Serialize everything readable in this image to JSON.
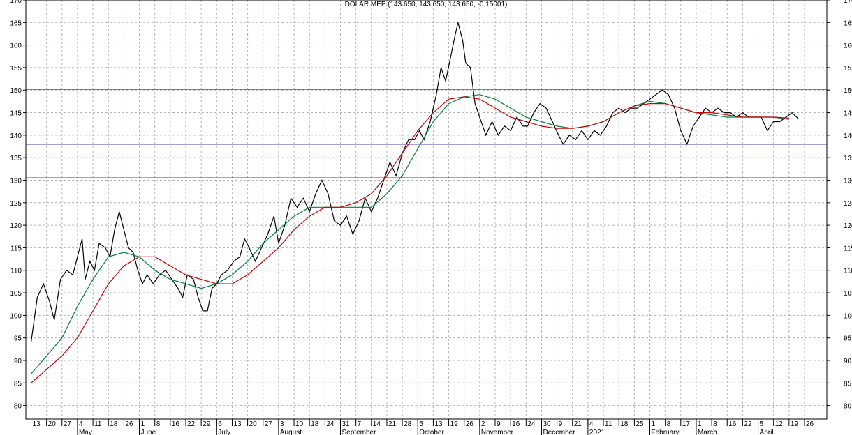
{
  "chart_data": {
    "type": "line",
    "title": "DOLAR MEP (143.650, 143.650, 143.650, -0.15001)",
    "ylim": [
      77,
      170
    ],
    "y_ticks": [
      80,
      85,
      90,
      95,
      100,
      105,
      110,
      115,
      120,
      125,
      130,
      135,
      140,
      145,
      150,
      155,
      160,
      165,
      170
    ],
    "x_day_ticks": [
      "13",
      "20",
      "27",
      "4",
      "11",
      "18",
      "26",
      "1",
      "8",
      "16",
      "22",
      "29",
      "6",
      "13",
      "20",
      "27",
      "3",
      "10",
      "18",
      "24",
      "31",
      "7",
      "14",
      "21",
      "28",
      "5",
      "13",
      "19",
      "26",
      "2",
      "9",
      "16",
      "24",
      "30",
      "9",
      "21",
      "4",
      "11",
      "18",
      "25",
      "1",
      "8",
      "17",
      "1",
      "8",
      "16",
      "22",
      "5",
      "12",
      "19",
      "26"
    ],
    "x_month_labels": [
      {
        "label": "May",
        "index": 3
      },
      {
        "label": "June",
        "index": 7
      },
      {
        "label": "July",
        "index": 12
      },
      {
        "label": "August",
        "index": 16
      },
      {
        "label": "September",
        "index": 20
      },
      {
        "label": "October",
        "index": 25
      },
      {
        "label": "November",
        "index": 29
      },
      {
        "label": "December",
        "index": 33
      },
      {
        "label": "2021",
        "index": 36
      },
      {
        "label": "February",
        "index": 40
      },
      {
        "label": "March",
        "index": 43
      },
      {
        "label": "April",
        "index": 47
      }
    ],
    "h_levels": [
      150.2,
      138,
      130.5
    ],
    "series": [
      {
        "color": "#000000",
        "points": [
          [
            0,
            94
          ],
          [
            0.4,
            104
          ],
          [
            0.8,
            107
          ],
          [
            1.2,
            103
          ],
          [
            1.5,
            99
          ],
          [
            1.9,
            108
          ],
          [
            2.3,
            110
          ],
          [
            2.7,
            109
          ],
          [
            3,
            113
          ],
          [
            3.3,
            117
          ],
          [
            3.5,
            108
          ],
          [
            3.8,
            112
          ],
          [
            4.1,
            110
          ],
          [
            4.4,
            116
          ],
          [
            4.8,
            115
          ],
          [
            5.1,
            113
          ],
          [
            5.4,
            119
          ],
          [
            5.7,
            123
          ],
          [
            6,
            119
          ],
          [
            6.3,
            115
          ],
          [
            6.6,
            114
          ],
          [
            6.9,
            110
          ],
          [
            7.2,
            107
          ],
          [
            7.5,
            109
          ],
          [
            7.9,
            107
          ],
          [
            8.3,
            109
          ],
          [
            8.7,
            110
          ],
          [
            9.1,
            108
          ],
          [
            9.5,
            106
          ],
          [
            9.8,
            104
          ],
          [
            10.1,
            109
          ],
          [
            10.5,
            108
          ],
          [
            10.8,
            104
          ],
          [
            11.1,
            101
          ],
          [
            11.4,
            101
          ],
          [
            11.7,
            106
          ],
          [
            12,
            107
          ],
          [
            12.3,
            109
          ],
          [
            12.7,
            110
          ],
          [
            13.1,
            112
          ],
          [
            13.5,
            113
          ],
          [
            13.8,
            117
          ],
          [
            14.1,
            115
          ],
          [
            14.5,
            112
          ],
          [
            14.9,
            115
          ],
          [
            15.3,
            118
          ],
          [
            15.7,
            122
          ],
          [
            16,
            116
          ],
          [
            16.4,
            120
          ],
          [
            16.8,
            126
          ],
          [
            17.2,
            124
          ],
          [
            17.6,
            126
          ],
          [
            18,
            123
          ],
          [
            18.4,
            127
          ],
          [
            18.8,
            130
          ],
          [
            19.2,
            127
          ],
          [
            19.6,
            121
          ],
          [
            20,
            120
          ],
          [
            20.4,
            122
          ],
          [
            20.8,
            118
          ],
          [
            21.2,
            121
          ],
          [
            21.6,
            126
          ],
          [
            22,
            123
          ],
          [
            22.4,
            126
          ],
          [
            22.8,
            130
          ],
          [
            23.2,
            134
          ],
          [
            23.6,
            131
          ],
          [
            24,
            136
          ],
          [
            24.4,
            139
          ],
          [
            24.8,
            139
          ],
          [
            25.1,
            141
          ],
          [
            25.4,
            139
          ],
          [
            25.8,
            143
          ],
          [
            26.2,
            149
          ],
          [
            26.5,
            155
          ],
          [
            26.8,
            152
          ],
          [
            27.1,
            157
          ],
          [
            27.4,
            162
          ],
          [
            27.6,
            165
          ],
          [
            27.9,
            161
          ],
          [
            28.1,
            156
          ],
          [
            28.4,
            155
          ],
          [
            28.7,
            147
          ],
          [
            29,
            144
          ],
          [
            29.4,
            140
          ],
          [
            29.8,
            143
          ],
          [
            30.2,
            140
          ],
          [
            30.6,
            142
          ],
          [
            31,
            141
          ],
          [
            31.4,
            144
          ],
          [
            31.8,
            142
          ],
          [
            32.1,
            142
          ],
          [
            32.5,
            145
          ],
          [
            32.9,
            147
          ],
          [
            33.3,
            146
          ],
          [
            33.7,
            143
          ],
          [
            34.1,
            140
          ],
          [
            34.4,
            138
          ],
          [
            34.8,
            140
          ],
          [
            35.2,
            139
          ],
          [
            35.6,
            141
          ],
          [
            36,
            139
          ],
          [
            36.4,
            141
          ],
          [
            36.8,
            140
          ],
          [
            37.2,
            142
          ],
          [
            37.6,
            145
          ],
          [
            38,
            146
          ],
          [
            38.4,
            145
          ],
          [
            38.8,
            146
          ],
          [
            39.2,
            146
          ],
          [
            39.6,
            147
          ],
          [
            40,
            148
          ],
          [
            40.4,
            149
          ],
          [
            40.8,
            150
          ],
          [
            41.2,
            149
          ],
          [
            41.6,
            146
          ],
          [
            42,
            141
          ],
          [
            42.4,
            138
          ],
          [
            42.8,
            142
          ],
          [
            43.2,
            144
          ],
          [
            43.6,
            146
          ],
          [
            44,
            145
          ],
          [
            44.4,
            146
          ],
          [
            44.8,
            145
          ],
          [
            45.2,
            145
          ],
          [
            45.6,
            144
          ],
          [
            46,
            145
          ],
          [
            46.4,
            144
          ],
          [
            46.8,
            144
          ],
          [
            47.2,
            144
          ],
          [
            47.6,
            141
          ],
          [
            48,
            143
          ],
          [
            48.4,
            143
          ],
          [
            48.8,
            144
          ],
          [
            49.2,
            145
          ],
          [
            49.6,
            143.65
          ]
        ]
      },
      {
        "color": "#008040",
        "points": [
          [
            0,
            87
          ],
          [
            1,
            91
          ],
          [
            2,
            95
          ],
          [
            3,
            102
          ],
          [
            4,
            108
          ],
          [
            5,
            113
          ],
          [
            6,
            114
          ],
          [
            7,
            113
          ],
          [
            8,
            110
          ],
          [
            9,
            108
          ],
          [
            10,
            107
          ],
          [
            11,
            106
          ],
          [
            12,
            107
          ],
          [
            13,
            109
          ],
          [
            14,
            112
          ],
          [
            15,
            116
          ],
          [
            16,
            119
          ],
          [
            17,
            122
          ],
          [
            18,
            124
          ],
          [
            19,
            124
          ],
          [
            20,
            124
          ],
          [
            21,
            124
          ],
          [
            22,
            124
          ],
          [
            23,
            127
          ],
          [
            24,
            131
          ],
          [
            25,
            137
          ],
          [
            26,
            143
          ],
          [
            27,
            147
          ],
          [
            28,
            148.5
          ],
          [
            29,
            149
          ],
          [
            30,
            148
          ],
          [
            31,
            146
          ],
          [
            32,
            144
          ],
          [
            33,
            143
          ],
          [
            34,
            142
          ],
          [
            35,
            141.5
          ],
          [
            36,
            142
          ],
          [
            37,
            143
          ],
          [
            38,
            145
          ],
          [
            39,
            146.5
          ],
          [
            40,
            147.5
          ],
          [
            41,
            147
          ],
          [
            42,
            146
          ],
          [
            43,
            145
          ],
          [
            44,
            144.5
          ],
          [
            45,
            144
          ],
          [
            46,
            144
          ],
          [
            47,
            144
          ],
          [
            48,
            144
          ],
          [
            49,
            143.5
          ]
        ]
      },
      {
        "color": "#cc0000",
        "points": [
          [
            0,
            85
          ],
          [
            1,
            88
          ],
          [
            2,
            91
          ],
          [
            3,
            95
          ],
          [
            4,
            101
          ],
          [
            5,
            107
          ],
          [
            6,
            111
          ],
          [
            7,
            113
          ],
          [
            8,
            113
          ],
          [
            9,
            111
          ],
          [
            10,
            109
          ],
          [
            11,
            108
          ],
          [
            12,
            107
          ],
          [
            13,
            107
          ],
          [
            14,
            109
          ],
          [
            15,
            112
          ],
          [
            16,
            115
          ],
          [
            17,
            119
          ],
          [
            18,
            122
          ],
          [
            19,
            124
          ],
          [
            20,
            124
          ],
          [
            21,
            125
          ],
          [
            22,
            127
          ],
          [
            23,
            131
          ],
          [
            24,
            136
          ],
          [
            25,
            141
          ],
          [
            26,
            145
          ],
          [
            27,
            148
          ],
          [
            28,
            148.5
          ],
          [
            29,
            148
          ],
          [
            30,
            146
          ],
          [
            31,
            144
          ],
          [
            32,
            143
          ],
          [
            33,
            142
          ],
          [
            34,
            141.5
          ],
          [
            35,
            141.5
          ],
          [
            36,
            142
          ],
          [
            37,
            143
          ],
          [
            38,
            145
          ],
          [
            39,
            146.5
          ],
          [
            40,
            147
          ],
          [
            41,
            147
          ],
          [
            42,
            146
          ],
          [
            43,
            145
          ],
          [
            44,
            145
          ],
          [
            45,
            144.5
          ],
          [
            46,
            144
          ],
          [
            47,
            144
          ],
          [
            48,
            144
          ],
          [
            49,
            143.8
          ]
        ]
      }
    ]
  }
}
